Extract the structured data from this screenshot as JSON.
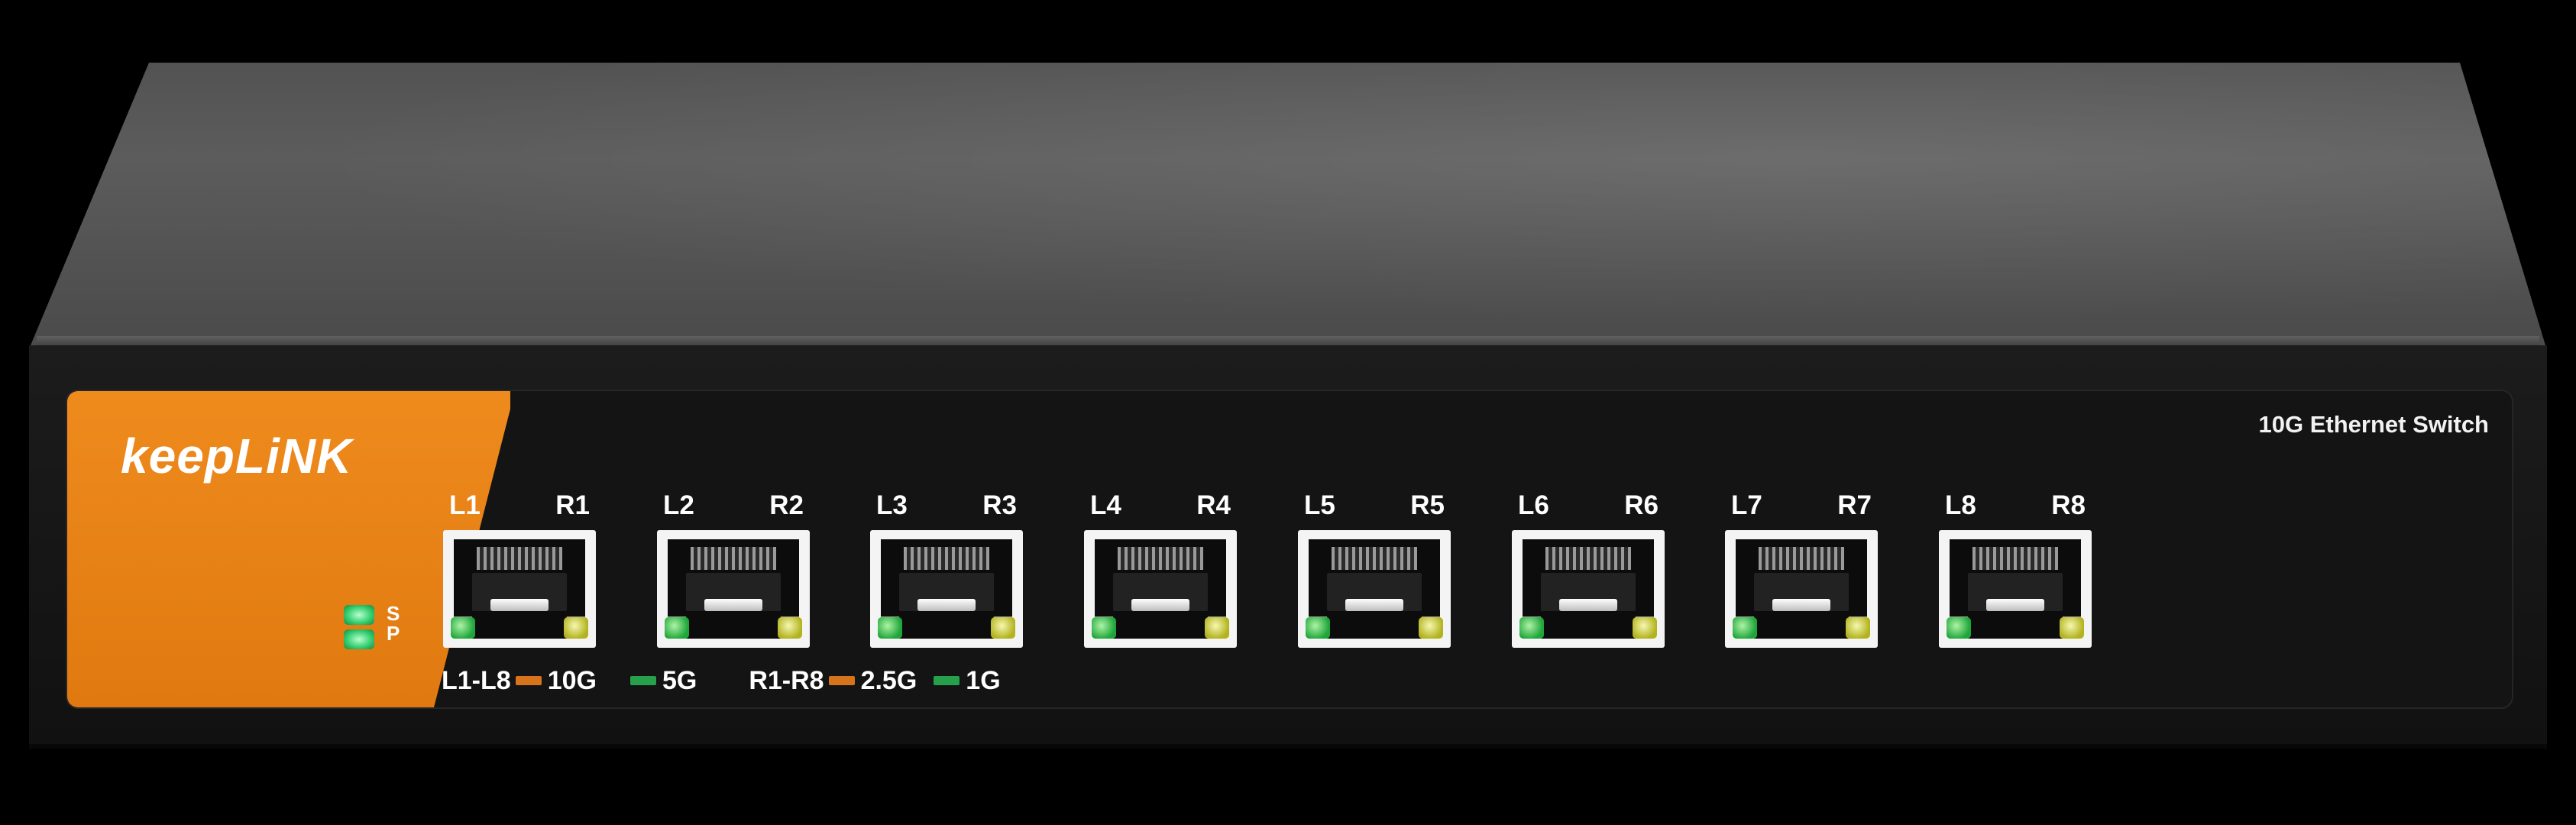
{
  "device": {
    "brand": "keepLiNK",
    "model_label": "10G Ethernet Switch"
  },
  "status_leds": [
    "S",
    "P"
  ],
  "ports": [
    {
      "left": "L1",
      "right": "R1"
    },
    {
      "left": "L2",
      "right": "R2"
    },
    {
      "left": "L3",
      "right": "R3"
    },
    {
      "left": "L4",
      "right": "R4"
    },
    {
      "left": "L5",
      "right": "R5"
    },
    {
      "left": "L6",
      "right": "R6"
    },
    {
      "left": "L7",
      "right": "R7"
    },
    {
      "left": "L8",
      "right": "R8"
    }
  ],
  "legend": {
    "l_group": "L1-L8",
    "l_speed_a": "10G",
    "l_speed_b": "5G",
    "r_group": "R1-R8",
    "r_speed_a": "2.5G",
    "r_speed_b": "1G"
  },
  "colors": {
    "brand_orange": "#e8841a",
    "led_green": "#2bb34a",
    "led_yellow": "#c9c92a",
    "chassis": "#151515"
  }
}
